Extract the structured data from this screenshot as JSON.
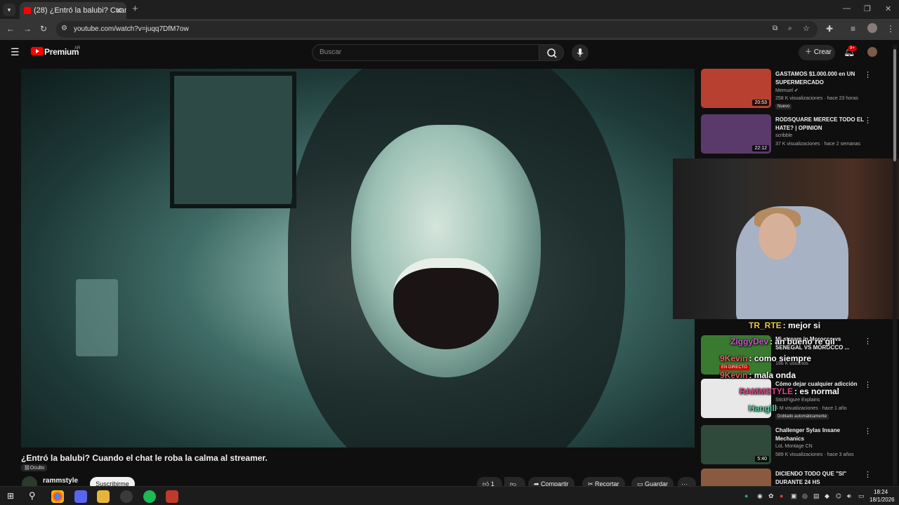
{
  "browser": {
    "tab_title": "(28) ¿Entró la balubi? Cuando e",
    "tab_close": "✕",
    "new_tab": "+",
    "url": "youtube.com/watch?v=juqq7DfM7ow"
  },
  "youtube": {
    "logo_text": "Premium",
    "region": "AR",
    "search_placeholder": "Buscar",
    "create_label": "Crear",
    "notifications_count": "9+"
  },
  "video": {
    "title": "¿Entró la balubi? Cuando el chat le roba la calma al streamer.",
    "visibility": "Oculto",
    "channel": "rammstyle",
    "subscribe_label": "Suscribirme",
    "likes": "1",
    "share_label": "Compartir",
    "clip_label": "Recortar",
    "save_label": "Guardar",
    "more_label": "···"
  },
  "recommended": [
    {
      "title": "GASTAMOS $1.000.000 en UN SUPERMERCADO",
      "channel": "Memuel",
      "meta": "258 K visualizaciones · hace 23 horas",
      "duration": "20:53",
      "badge": "Nuevo",
      "thumb_color": "#b84030"
    },
    {
      "title": "RODSQUARE MERECE TODO EL HATE? | OPINION",
      "channel": "scribble",
      "meta": "37 K visualizaciones · hace 2 semanas",
      "duration": "22:12",
      "badge": "",
      "thumb_color": "#5a3a6a"
    },
    {
      "title": "Challenger Sylas Insane Mechanics",
      "channel": "LoL Montage CN",
      "meta": "589 K visualizaciones · hace 3 años",
      "duration": "5:40",
      "badge": "",
      "thumb_color": "#2f4a3a"
    },
    {
      "title": "DICIENDO TODO QUE \"SI\" DURANTE 24 HS",
      "channel": "",
      "meta": "",
      "duration": "",
      "badge": "",
      "thumb_color": "#8a5a40"
    }
  ],
  "partial_recommended": [
    {
      "title": "Mi stream in Morocco vs SENEGAL VS MOROCCO ...",
      "meta": "196 K usuarios",
      "badge": "EN DIRECTO"
    },
    {
      "title": "Cómo dejar cualquier adicción",
      "channel": "StickFigure Explains",
      "meta": "4 M visualizaciones · hace 1 año",
      "badge": "Doblado automáticamente"
    }
  ],
  "chat": [
    {
      "nick": "TR_RTE",
      "text": ": mejor si",
      "color": "#e6c84a"
    },
    {
      "nick": "ZiggyDev",
      "text": ": an bueno re gil",
      "color": "#d04fd0"
    },
    {
      "nick": "9Kevin",
      "text": ": como siempre",
      "color": "#e06060"
    },
    {
      "nick": "9Kevin",
      "text": ": mala onda",
      "color": "#e06060"
    },
    {
      "nick": "RAMMSTYLE",
      "text": ": es normal",
      "color": "#e0458a"
    },
    {
      "nick": "Hangill",
      "text": "",
      "color": "#55d0a0"
    }
  ],
  "taskbar": {
    "time": "18:24",
    "date": "18/1/2026"
  }
}
